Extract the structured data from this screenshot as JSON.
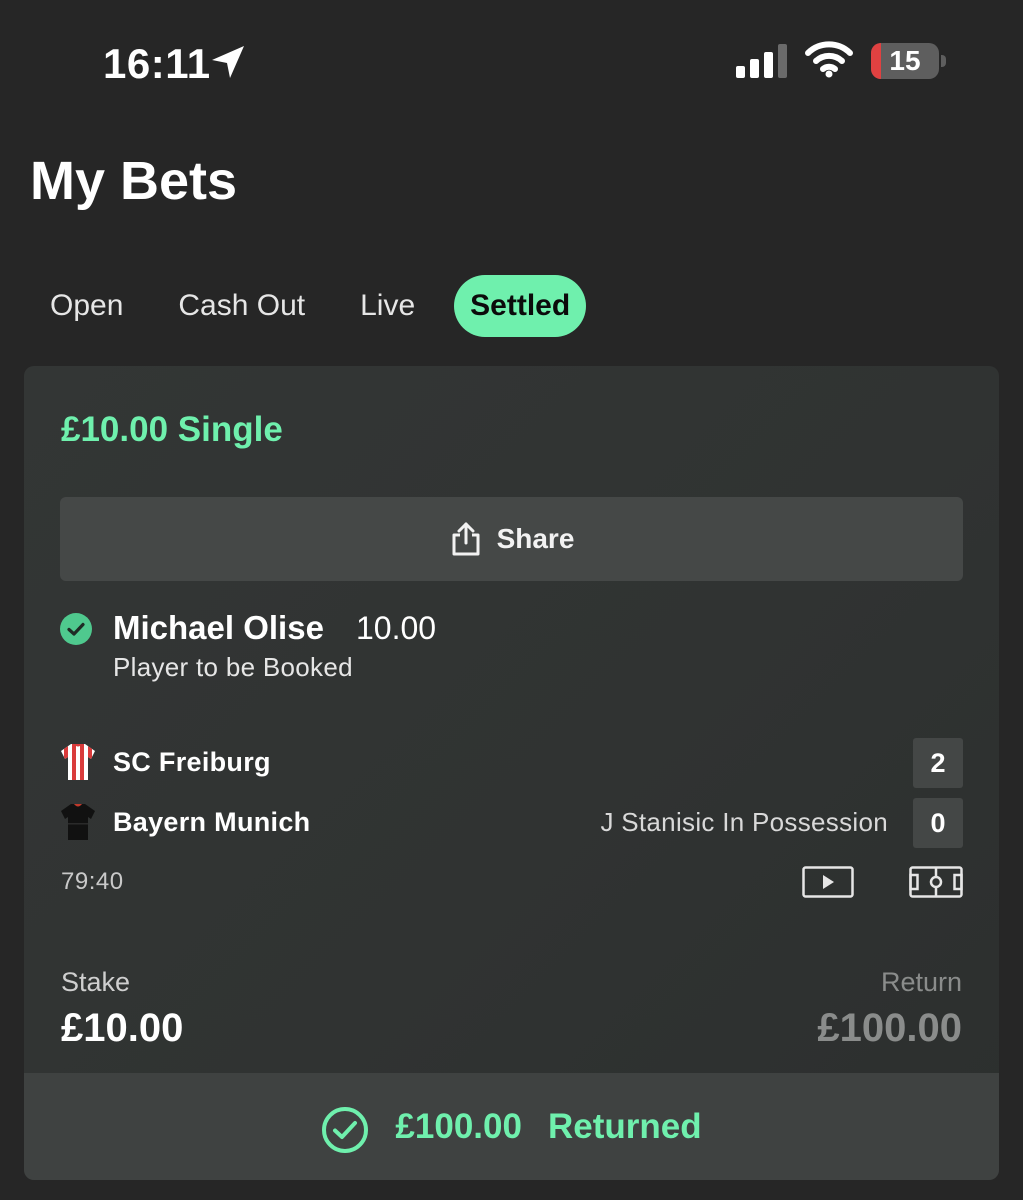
{
  "status_bar": {
    "time": "16:11",
    "battery_level": "15",
    "battery_percent": 15,
    "icons": [
      "location-arrow-icon",
      "cellular-signal-icon",
      "wifi-icon",
      "battery-icon"
    ]
  },
  "header": {
    "title": "My Bets"
  },
  "tabs": [
    {
      "label": "Open",
      "active": false
    },
    {
      "label": "Cash Out",
      "active": false
    },
    {
      "label": "Live",
      "active": false
    },
    {
      "label": "Settled",
      "active": true
    }
  ],
  "bet": {
    "title": "£10.00 Single",
    "share_label": "Share",
    "selection": {
      "name": "Michael Olise",
      "odds": "10.00",
      "market": "Player to be Booked",
      "status_icon": "check-circle-icon"
    },
    "match": {
      "home_team": {
        "name": "SC Freiburg",
        "score": "2",
        "kit_icon": "jersey-red-white-stripes-icon"
      },
      "away_team": {
        "name": "Bayern Munich",
        "score": "0",
        "kit_icon": "jersey-black-icon"
      },
      "status_text": "J Stanisic In Possession",
      "clock": "79:40",
      "icons": [
        "video-play-icon",
        "pitch-icon"
      ]
    },
    "stake": {
      "label": "Stake",
      "value": "£10.00"
    },
    "return": {
      "label": "Return",
      "value": "£100.00"
    },
    "result": {
      "amount": "£100.00",
      "label": "Returned"
    }
  },
  "colors": {
    "background": "#262626",
    "card": "#323534",
    "accent_green": "#6ff0ad",
    "battery_low": "#e04141"
  }
}
